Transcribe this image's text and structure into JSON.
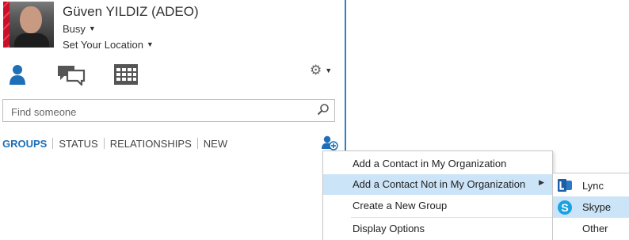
{
  "profile": {
    "name": "Güven YILDIZ (ADEO)",
    "status": "Busy",
    "location": "Set Your Location",
    "presence_color": "#c8102e"
  },
  "nav": {
    "icons": [
      "contacts-icon",
      "conversations-icon",
      "meetings-icon",
      "gear-icon"
    ]
  },
  "search": {
    "placeholder": "Find someone"
  },
  "tabs": [
    "GROUPS",
    "STATUS",
    "RELATIONSHIPS",
    "NEW"
  ],
  "context_menu": {
    "items": [
      "Add a Contact in My Organization",
      "Add a Contact Not in My Organization",
      "Create a New Group",
      "Display Options"
    ]
  },
  "submenu": {
    "items": [
      "Lync",
      "Skype",
      "Other"
    ]
  },
  "colors": {
    "accent": "#1d6fb8",
    "highlight": "#cce4f7",
    "window_border": "#2f7fc7"
  }
}
